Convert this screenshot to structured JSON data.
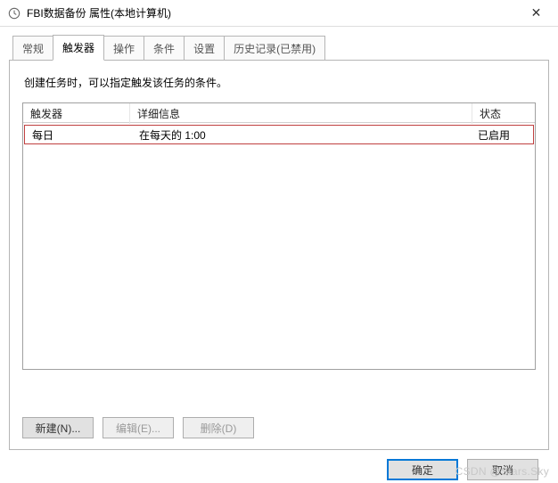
{
  "window": {
    "title": "FBI数据备份 属性(本地计算机)",
    "close_label": "✕"
  },
  "tabs": {
    "general": "常规",
    "triggers": "触发器",
    "actions": "操作",
    "conditions": "条件",
    "settings": "设置",
    "history": "历史记录(已禁用)"
  },
  "triggers_panel": {
    "description": "创建任务时，可以指定触发该任务的条件。",
    "columns": {
      "trigger": "触发器",
      "details": "详细信息",
      "status": "状态"
    },
    "rows": [
      {
        "trigger": "每日",
        "details": "在每天的 1:00",
        "status": "已启用"
      }
    ],
    "buttons": {
      "new": "新建(N)...",
      "edit": "编辑(E)...",
      "delete": "删除(D)"
    }
  },
  "dialog_buttons": {
    "ok": "确定",
    "cancel": "取消"
  },
  "watermark": "CSDN @Stars.Sky"
}
